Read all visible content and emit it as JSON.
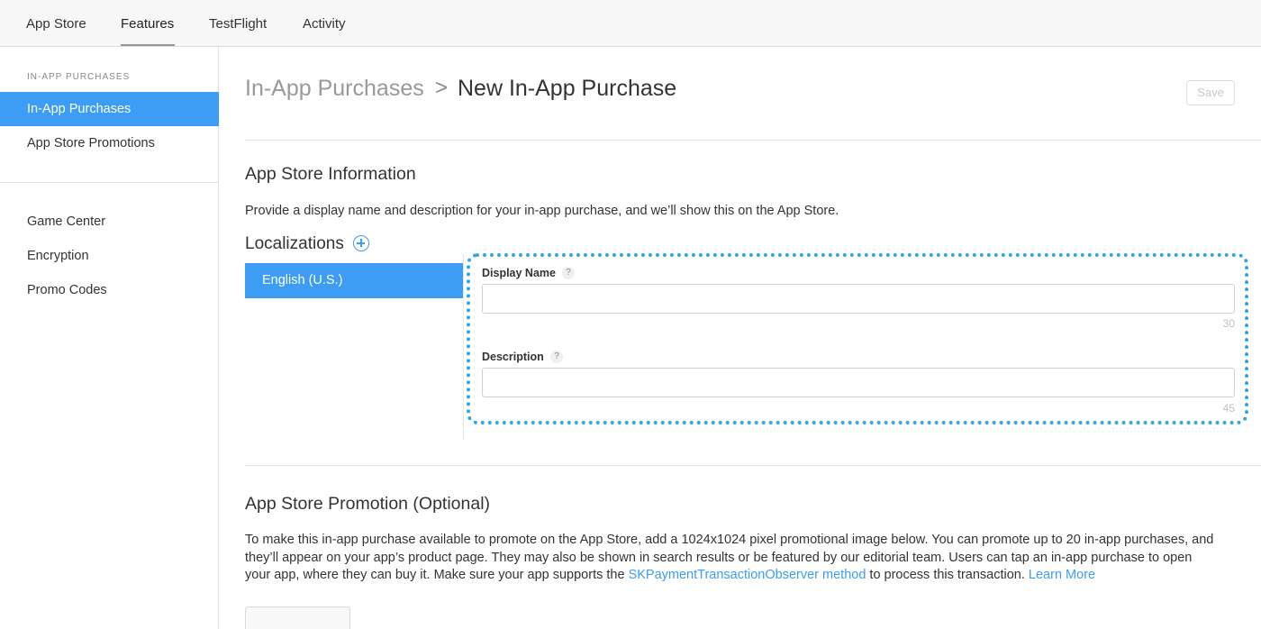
{
  "topnav": {
    "tabs": [
      "App Store",
      "Features",
      "TestFlight",
      "Activity"
    ]
  },
  "sidebar": {
    "section_label": "IN-APP PURCHASES",
    "items": [
      "In-App Purchases",
      "App Store Promotions",
      "Game Center",
      "Encryption",
      "Promo Codes"
    ]
  },
  "header": {
    "crumb_parent": "In-App Purchases",
    "crumb_separator": ">",
    "crumb_current": "New In-App Purchase",
    "save_label": "Save"
  },
  "info": {
    "title": "App Store Information",
    "description": "Provide a display name and description for your in-app purchase, and we’ll show this on the App Store.",
    "localizations_title": "Localizations",
    "language": "English (U.S.)",
    "display_name_label": "Display Name",
    "display_name_value": "",
    "display_name_limit": "30",
    "description_label": "Description",
    "description_value": "",
    "description_limit": "45",
    "help_glyph": "?"
  },
  "promotion": {
    "title": "App Store Promotion (Optional)",
    "line1": "To make this in-app purchase available to promote on the App Store, add a 1024x1024 pixel promotional image below. You can promote up to 20 in-app purchases, and",
    "line2": "they’ll appear on your app’s product page. They may also be shown in search results or be featured by our editorial team. Users can tap an in-app purchase to open",
    "line3_pre": "your app, where they can buy it. Make sure your app supports the ",
    "line3_link": "SKPaymentTransactionObserver method",
    "line3_mid": " to process this transaction. ",
    "line3_learn": "Learn More"
  },
  "colors": {
    "accent": "#3d9cf3",
    "highlight_border": "#2fa6e6"
  }
}
